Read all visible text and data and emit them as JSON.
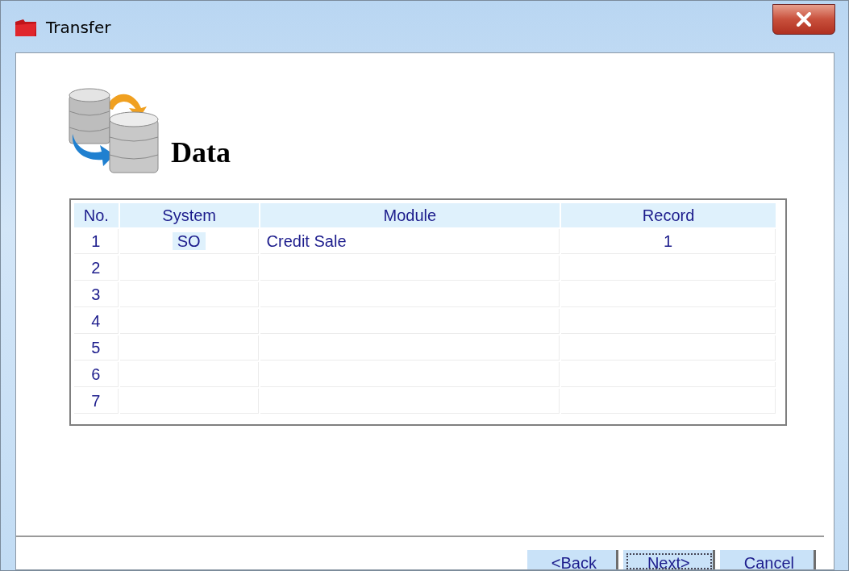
{
  "window": {
    "title": "Transfer"
  },
  "heading": "Data",
  "table": {
    "columns": [
      "No.",
      "System",
      "Module",
      "Record"
    ],
    "rows": [
      {
        "no": "1",
        "system": "SO",
        "module": "Credit Sale",
        "record": "1",
        "selected": true
      },
      {
        "no": "2"
      },
      {
        "no": "3"
      },
      {
        "no": "4"
      },
      {
        "no": "5"
      },
      {
        "no": "6"
      },
      {
        "no": "7"
      }
    ]
  },
  "buttons": [
    {
      "label": "<Back",
      "focused": false
    },
    {
      "label": "Next>",
      "focused": true
    },
    {
      "label": "Cancel",
      "focused": false
    }
  ]
}
